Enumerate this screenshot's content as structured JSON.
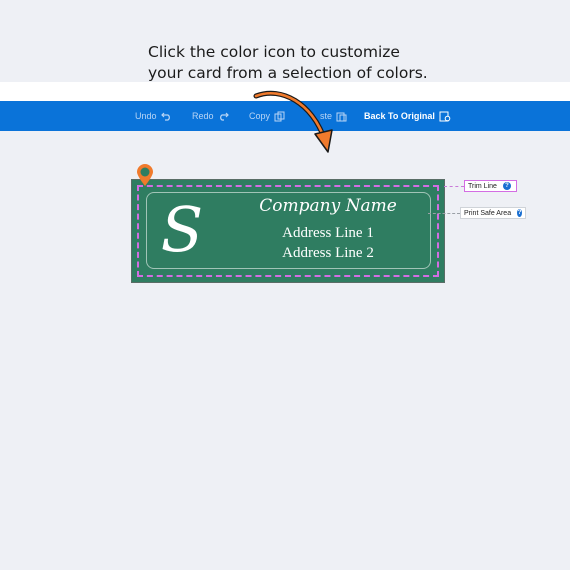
{
  "instruction": {
    "line1": "Click the color icon to customize",
    "line2": "your card from a selection of colors."
  },
  "toolbar": {
    "undo_label": "Undo",
    "redo_label": "Redo",
    "copy_label": "Copy",
    "paste_label": "ste",
    "back_label": "Back To Original"
  },
  "card": {
    "monogram": "S",
    "company": "Company Name",
    "address_line1": "Address Line 1",
    "address_line2": "Address Line 2",
    "background_color": "#2f7d61",
    "pin_color": "#f07a2c"
  },
  "guides": {
    "trim_label": "Trim Line",
    "safe_label": "Print Safe Area",
    "help_glyph": "?",
    "trim_color": "#d36de3"
  },
  "colors": {
    "toolbar": "#0a73d9",
    "page_bg": "#eef0f5"
  }
}
